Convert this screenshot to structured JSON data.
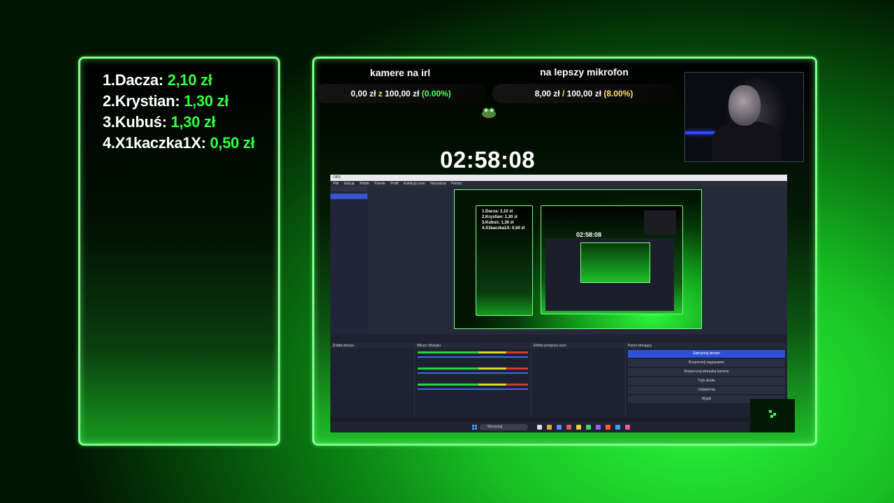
{
  "leaderboard": [
    {
      "rank": "1.",
      "name": "Dacza:",
      "amount": "2,10 zł"
    },
    {
      "rank": "2.",
      "name": "Krystian:",
      "amount": "1,30 zł"
    },
    {
      "rank": "3.",
      "name": "Kubuś:",
      "amount": "1,30 zł"
    },
    {
      "rank": "4.",
      "name": "X1kaczka1X:",
      "amount": "0,50 zł"
    }
  ],
  "goals": [
    {
      "title": "kamere na irl",
      "current": "0,00 zł",
      "sep": "z",
      "target": "100,00 zł",
      "percent": "(0.00%)"
    },
    {
      "title": "na lepszy mikrofon",
      "current": "8,00 zł",
      "sep": "/",
      "target": "100,00 zł",
      "percent": "(8.00%)"
    }
  ],
  "timer": "02:58:08",
  "obs": {
    "menu": [
      "Plik",
      "Edycja",
      "Widok",
      "Panele",
      "Profil",
      "Kolekcja scen",
      "Narzędzia",
      "Pomoc"
    ],
    "taskbar_search": "Wyszukaj",
    "docks": [
      "Źródła obrazu",
      "Mikser dźwięku",
      "Efekty przejścia scen",
      "Panel sterujący"
    ],
    "controls": [
      "Zatrzymaj stream",
      "Rozpocznij nagrywanie",
      "Rozpocznij wirtualną kamerę",
      "Tryb studia",
      "Ustawienia",
      "Wyjdź"
    ]
  },
  "mini": {
    "lines": [
      "1.Dacza: 2,10 zł",
      "2.Krystian: 1,30 zł",
      "3.Kubuś: 1,30 zł",
      "4.X1kaczka1X: 0,50 zł"
    ],
    "timer": "02:58:08"
  },
  "colors": {
    "accent": "#33ff44",
    "border": "#7dff8a",
    "percent_yellow": "#ffe066"
  }
}
